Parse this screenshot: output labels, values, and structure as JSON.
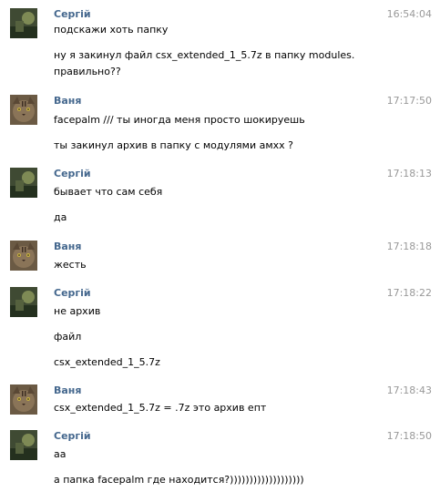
{
  "messages": [
    {
      "author": "Сергій",
      "avatar": "sergii-avatar",
      "time": "16:54:04",
      "lines": [
        "подскажи хоть папку",
        "ну я закинул файл csx_extended_1_5.7z в папку modules.",
        "правильно??"
      ]
    },
    {
      "author": "Ваня",
      "avatar": "vanya-cat-avatar",
      "time": "17:17:50",
      "lines": [
        "facepalm /// ты иногда меня просто шокируешь",
        "ты закинул архив в папку с модулями амхх ?"
      ]
    },
    {
      "author": "Сергій",
      "avatar": "sergii-avatar",
      "time": "17:18:13",
      "lines": [
        "бывает что сам себя",
        "да"
      ]
    },
    {
      "author": "Ваня",
      "avatar": "vanya-cat-avatar",
      "time": "17:18:18",
      "lines": [
        "жесть"
      ]
    },
    {
      "author": "Сергій",
      "avatar": "sergii-avatar",
      "time": "17:18:22",
      "lines": [
        "не архив",
        "файл",
        "csx_extended_1_5.7z"
      ]
    },
    {
      "author": "Ваня",
      "avatar": "vanya-cat-avatar",
      "time": "17:18:43",
      "lines": [
        "csx_extended_1_5.7z = .7z это архив епт"
      ]
    },
    {
      "author": "Сергій",
      "avatar": "sergii-avatar",
      "time": "17:18:50",
      "lines": [
        "аа",
        "а папка facepalm где находится?)))))))))))))))))))"
      ]
    }
  ],
  "colors": {
    "author": "#45688e",
    "time": "#999999",
    "text": "#000000"
  }
}
